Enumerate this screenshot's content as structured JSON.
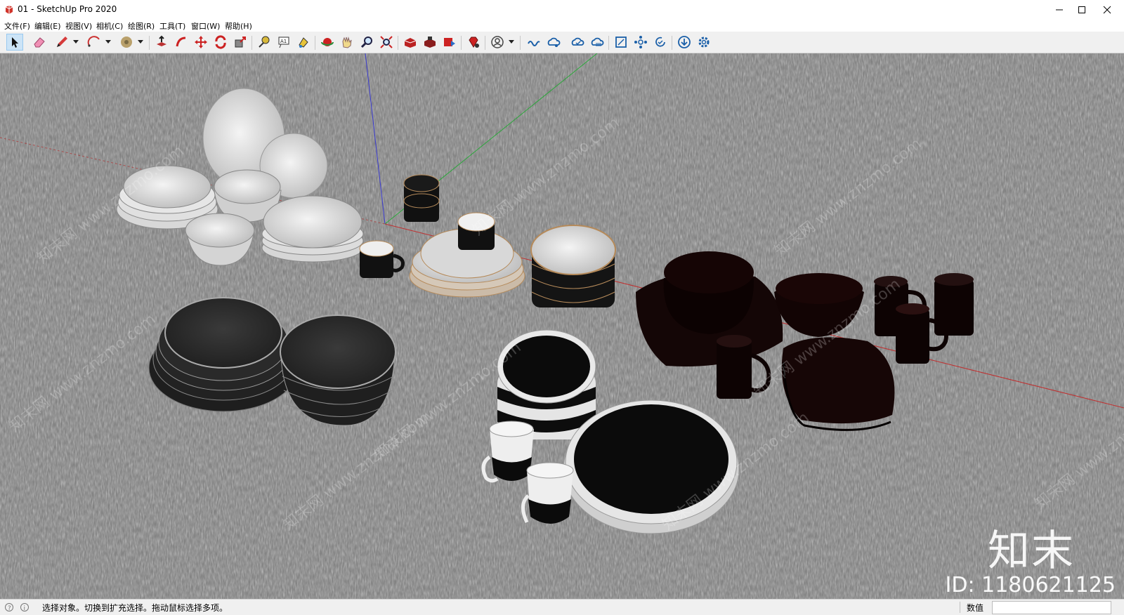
{
  "window": {
    "title": "01 - SketchUp Pro 2020"
  },
  "menu": [
    "文件(F)",
    "编辑(E)",
    "视图(V)",
    "相机(C)",
    "绘图(R)",
    "工具(T)",
    "窗口(W)",
    "帮助(H)"
  ],
  "toolbar": {
    "icons": [
      "select-icon",
      "eraser-icon",
      "pencil-icon",
      "arc-icon",
      "paint-bucket-icon",
      "push-pull-icon",
      "follow-me-icon",
      "move-icon",
      "rotate-icon",
      "scale-icon",
      "tape-measure-icon",
      "text-icon",
      "paint-icon",
      "orbit-icon",
      "pan-icon",
      "zoom-icon",
      "zoom-extents-icon",
      "warehouse-icon",
      "extension-warehouse-icon",
      "layout-icon",
      "ruby-icon",
      "account-icon",
      "trimble-connect-icon",
      "trimble-share-icon",
      "cloud-sync-icon",
      "cloud-upload-icon",
      "scene-icon",
      "component-icon",
      "update-icon",
      "download-icon",
      "settings-icon"
    ]
  },
  "status": {
    "message": "选择对象。切换到扩充选择。拖动鼠标选择多项。",
    "measure_label": "数值",
    "measure_value": ""
  },
  "watermark": {
    "logo": "知末",
    "id": "ID: 1180621125",
    "repeat_text": "知末网 www.znzmo.com"
  },
  "colors": {
    "accent": "#cce4f7",
    "ground": "#7a7a7a"
  }
}
